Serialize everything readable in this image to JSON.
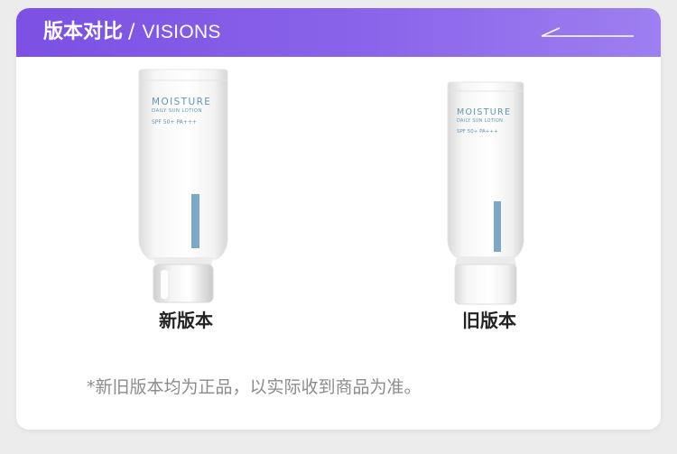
{
  "header": {
    "title_cn": "版本对比",
    "separator": "/",
    "title_en": "VISIONS"
  },
  "products": [
    {
      "label": "新版本",
      "tube": {
        "line1": "MOISTURE",
        "line2": "DAILY SUN LOTION",
        "spf": "SPF 50+ PA+++"
      }
    },
    {
      "label": "旧版本",
      "tube": {
        "line1": "MOISTURE",
        "line2": "DAILY SUN LOTION",
        "spf": "SPF 50+ PA+++"
      }
    }
  ],
  "note": "*新旧版本均为正品，以实际收到商品为准。",
  "colors": {
    "header_gradient_start": "#7b50e3",
    "header_gradient_end": "#9e7ff0",
    "tube_accent": "#5f95b8",
    "label_text": "#222222",
    "note_text": "#8c8c8c"
  }
}
